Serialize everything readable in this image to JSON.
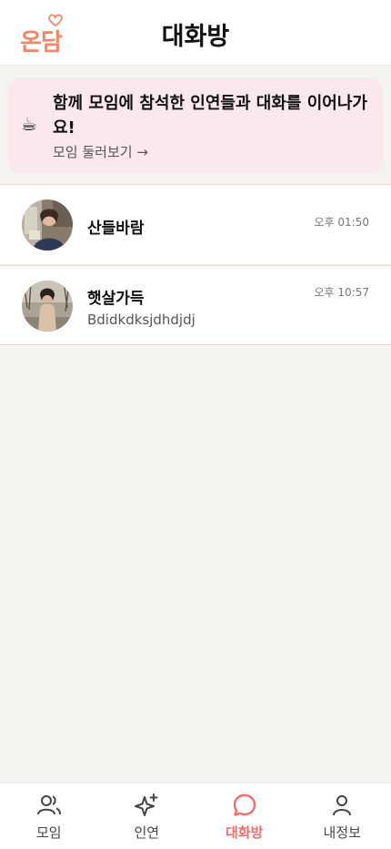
{
  "header": {
    "logo_text": "온담",
    "title": "대화방"
  },
  "banner": {
    "icon": "coffee-icon",
    "title": "함께 모임에 참석한 인연들과 대화를 이어나가요!",
    "link": "모임 둘러보기 →"
  },
  "chats": [
    {
      "name": "산들바람",
      "preview": "",
      "time": "오후 01:50"
    },
    {
      "name": "햇살가득",
      "preview": "Bdidkdksjdhdjdj",
      "time": "오후 10:57"
    }
  ],
  "nav": {
    "active_color": "#ef6e6e",
    "items": [
      {
        "label": "모임",
        "icon": "people-icon"
      },
      {
        "label": "인연",
        "icon": "sparkle-icon"
      },
      {
        "label": "대화방",
        "icon": "chat-bubble-icon"
      },
      {
        "label": "내정보",
        "icon": "person-icon"
      }
    ]
  }
}
